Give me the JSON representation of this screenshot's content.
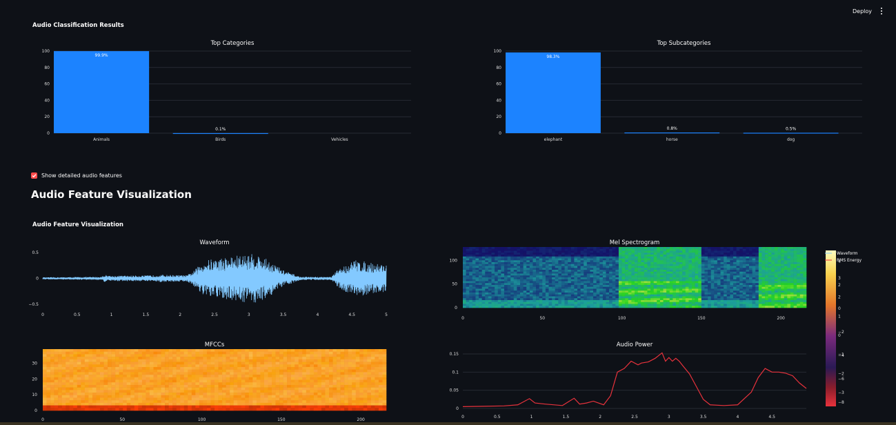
{
  "header": {
    "deploy_label": "Deploy"
  },
  "results_title": "Audio Classification Results",
  "checkbox": {
    "label": "Show detailed audio features",
    "checked": true
  },
  "viz_heading": "Audio Feature Visualization",
  "viz_subtitle": "Audio Feature Visualization",
  "colors": {
    "bar": "#1c83ff",
    "background": "#0e1117",
    "checkbox": "#ff4b4b",
    "waveform": "#83c9ff",
    "power_line": "#e8323c"
  },
  "chart_data": [
    {
      "type": "bar",
      "title": "Top Categories",
      "categories": [
        "Animals",
        "Birds",
        "Vehicles"
      ],
      "values": [
        99.9,
        0.1,
        0
      ],
      "data_labels": [
        "99.9%",
        "0.1%",
        ""
      ],
      "ylim": [
        0,
        100
      ],
      "yticks": [
        "100",
        "80",
        "60",
        "40",
        "20",
        "0"
      ]
    },
    {
      "type": "bar",
      "title": "Top Subcategories",
      "categories": [
        "elephant",
        "horse",
        "dog"
      ],
      "values": [
        98.3,
        0.8,
        0.5
      ],
      "data_labels": [
        "98.3%",
        "0.8%",
        "0.5%"
      ],
      "ylim": [
        0,
        100
      ],
      "yticks": [
        "100",
        "80",
        "60",
        "40",
        "20",
        "0"
      ]
    },
    {
      "type": "line",
      "title": "Waveform",
      "xlim": [
        0,
        5
      ],
      "ylim": [
        -0.5,
        0.5
      ],
      "xticks": [
        "0",
        "0.5",
        "1",
        "1.5",
        "2",
        "2.5",
        "3",
        "3.5",
        "4",
        "4.5",
        "5"
      ],
      "yticks": [
        "0.5",
        "0",
        "−0.5"
      ],
      "envelope": [
        [
          0,
          0.02
        ],
        [
          0.85,
          0.03
        ],
        [
          0.9,
          0.07
        ],
        [
          1.0,
          0.05
        ],
        [
          1.6,
          0.06
        ],
        [
          1.7,
          0.07
        ],
        [
          2.1,
          0.06
        ],
        [
          2.2,
          0.15
        ],
        [
          2.35,
          0.35
        ],
        [
          2.6,
          0.4
        ],
        [
          2.85,
          0.45
        ],
        [
          3.1,
          0.48
        ],
        [
          3.3,
          0.35
        ],
        [
          3.5,
          0.16
        ],
        [
          3.75,
          0.03
        ],
        [
          4.2,
          0.03
        ],
        [
          4.3,
          0.18
        ],
        [
          4.55,
          0.36
        ],
        [
          4.8,
          0.3
        ],
        [
          5.0,
          0.28
        ]
      ]
    },
    {
      "type": "heatmap",
      "title": "Mel Spectrogram",
      "xlim": [
        0,
        216
      ],
      "ylim": [
        0,
        128
      ],
      "xticks": [
        "0",
        "50",
        "100",
        "150",
        "200"
      ],
      "yticks": [
        "100",
        "50",
        "0"
      ],
      "colorbar": {
        "ticks_outer": [
          "4",
          "2",
          "0",
          "−2",
          "−4",
          "−6",
          "−8"
        ],
        "ticks_inner": [
          "3",
          "2",
          "1",
          "0",
          "−1",
          "−2",
          "−3"
        ]
      }
    },
    {
      "type": "heatmap",
      "title": "MFCCs",
      "xlim": [
        0,
        216
      ],
      "ylim": [
        0,
        39
      ],
      "xticks": [
        "0",
        "50",
        "100",
        "150",
        "200"
      ],
      "yticks": [
        "30",
        "20",
        "10",
        "0"
      ]
    },
    {
      "type": "line",
      "title": "Audio Power",
      "xlim": [
        0,
        5
      ],
      "ylim": [
        0,
        0.15
      ],
      "xticks": [
        "0",
        "0.5",
        "1",
        "1.5",
        "2",
        "2.5",
        "3",
        "3.5",
        "4",
        "4.5"
      ],
      "yticks": [
        "0.15",
        "0.1",
        "0.05",
        "0"
      ],
      "x": [
        0,
        0.3,
        0.6,
        0.8,
        0.9,
        0.97,
        1.05,
        1.2,
        1.45,
        1.55,
        1.62,
        1.7,
        1.8,
        1.9,
        2.05,
        2.15,
        2.25,
        2.35,
        2.45,
        2.55,
        2.6,
        2.7,
        2.8,
        2.9,
        2.95,
        3.0,
        3.05,
        3.1,
        3.15,
        3.2,
        3.3,
        3.4,
        3.5,
        3.6,
        3.8,
        4.0,
        4.2,
        4.3,
        4.4,
        4.5,
        4.6,
        4.7,
        4.8,
        4.9,
        5.0
      ],
      "y": [
        0.005,
        0.006,
        0.007,
        0.01,
        0.02,
        0.027,
        0.015,
        0.012,
        0.008,
        0.02,
        0.028,
        0.012,
        0.015,
        0.02,
        0.01,
        0.035,
        0.1,
        0.11,
        0.13,
        0.12,
        0.125,
        0.128,
        0.138,
        0.153,
        0.13,
        0.14,
        0.13,
        0.138,
        0.13,
        0.118,
        0.095,
        0.06,
        0.025,
        0.01,
        0.008,
        0.01,
        0.045,
        0.085,
        0.11,
        0.1,
        0.1,
        0.097,
        0.09,
        0.07,
        0.055
      ],
      "legend": [
        "Waveform",
        "RMS Energy"
      ]
    }
  ]
}
